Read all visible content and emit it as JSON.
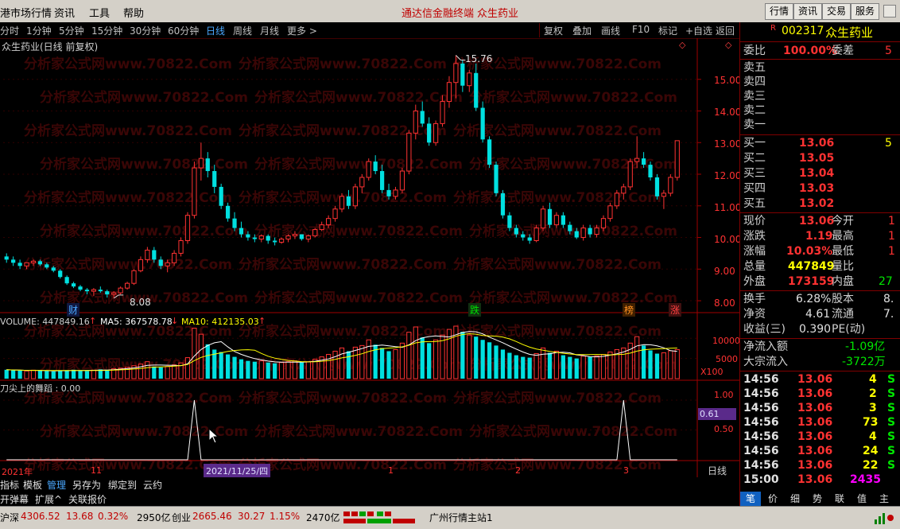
{
  "menubar": {
    "items": [
      "港市场行情",
      "资讯",
      "工具",
      "帮助"
    ],
    "app_title": "通达信金融终端",
    "stock_title": "众生药业",
    "right_buttons": [
      "行情",
      "资讯",
      "交易",
      "服务"
    ]
  },
  "periodbar": {
    "periods": [
      "分时",
      "1分钟",
      "5分钟",
      "15分钟",
      "30分钟",
      "60分钟",
      "日线",
      "周线",
      "月线",
      "更多 >"
    ],
    "active": "日线",
    "right_buttons": [
      "复权",
      "叠加",
      "画线",
      "F10",
      "标记",
      "+自选",
      "返回"
    ]
  },
  "chart": {
    "title": "众生药业(日线 前复权)",
    "high_label": "15.76",
    "low_label": "8.08",
    "y_ticks": [
      "15.00",
      "14.00",
      "13.00",
      "12.00",
      "11.00",
      "10.00",
      "9.00",
      "8.00"
    ],
    "event_tags": [
      "财",
      "跌",
      "榜",
      "涨"
    ],
    "volume_legend": {
      "volume": "VOLUME: 447849.16",
      "ma5": "MA5: 367578.78",
      "ma10": "MA10: 412135.03"
    },
    "volume_ticks": [
      "10000",
      "5000",
      "X100"
    ],
    "indicator_legend": "刀尖上的舞蹈 : 0.00",
    "indicator_ticks": [
      "1.00",
      "0.50"
    ],
    "indicator_value": "0.61",
    "date_axis": {
      "year": "2021年",
      "labels": [
        "11",
        "1",
        "2",
        "3"
      ],
      "cursor_date": "2021/11/25/四"
    },
    "period_label": "日线",
    "zoom_controls": [
      "+",
      "-",
      "0"
    ],
    "watermark": "分析家公式网www.70822.Com",
    "chart_data": {
      "type": "candlestick",
      "ylim": [
        7.8,
        16.1
      ],
      "y_ticks": [
        15,
        14,
        13,
        12,
        11,
        10,
        9,
        8
      ],
      "high": 15.76,
      "low": 8.08,
      "candles_ohlc": [
        [
          9.4,
          9.5,
          9.2,
          9.3
        ],
        [
          9.3,
          9.4,
          9.1,
          9.2
        ],
        [
          9.2,
          9.3,
          9.0,
          9.1
        ],
        [
          9.1,
          9.2,
          9.0,
          9.2
        ],
        [
          9.2,
          9.3,
          9.1,
          9.25
        ],
        [
          9.25,
          9.3,
          9.1,
          9.15
        ],
        [
          9.15,
          9.2,
          9.0,
          9.05
        ],
        [
          9.05,
          9.1,
          8.9,
          8.95
        ],
        [
          8.95,
          9.0,
          8.7,
          8.75
        ],
        [
          8.75,
          8.8,
          8.5,
          8.55
        ],
        [
          8.55,
          8.6,
          8.4,
          8.45
        ],
        [
          8.45,
          8.5,
          8.3,
          8.35
        ],
        [
          8.35,
          8.4,
          8.2,
          8.3
        ],
        [
          8.3,
          8.4,
          8.15,
          8.35
        ],
        [
          8.35,
          8.45,
          8.25,
          8.3
        ],
        [
          8.3,
          8.35,
          8.1,
          8.2
        ],
        [
          8.2,
          8.3,
          8.08,
          8.25
        ],
        [
          8.25,
          8.45,
          8.2,
          8.4
        ],
        [
          8.4,
          8.6,
          8.35,
          8.55
        ],
        [
          8.55,
          9.0,
          8.5,
          8.95
        ],
        [
          8.95,
          9.4,
          8.9,
          9.3
        ],
        [
          9.3,
          9.7,
          9.2,
          9.6
        ],
        [
          9.6,
          9.7,
          9.2,
          9.3
        ],
        [
          9.3,
          9.4,
          9.0,
          9.1
        ],
        [
          9.1,
          9.3,
          8.9,
          9.2
        ],
        [
          9.2,
          9.6,
          9.1,
          9.5
        ],
        [
          9.5,
          10.0,
          9.4,
          9.9
        ],
        [
          9.9,
          10.8,
          9.8,
          10.7
        ],
        [
          10.7,
          12.4,
          10.6,
          12.2
        ],
        [
          12.2,
          13.0,
          11.8,
          12.5
        ],
        [
          12.5,
          12.7,
          11.9,
          12.1
        ],
        [
          12.1,
          12.3,
          11.4,
          11.6
        ],
        [
          11.6,
          11.7,
          10.9,
          11.0
        ],
        [
          11.0,
          11.1,
          10.5,
          10.6
        ],
        [
          10.6,
          10.8,
          10.2,
          10.3
        ],
        [
          10.3,
          10.5,
          10.0,
          10.1
        ],
        [
          10.1,
          10.2,
          9.9,
          10.0
        ],
        [
          10.0,
          10.1,
          9.85,
          9.95
        ],
        [
          9.95,
          10.1,
          9.85,
          10.05
        ],
        [
          10.05,
          10.1,
          9.8,
          9.9
        ],
        [
          9.9,
          10.0,
          9.75,
          9.85
        ],
        [
          9.85,
          10.0,
          9.8,
          9.95
        ],
        [
          9.95,
          10.1,
          9.85,
          10.05
        ],
        [
          10.05,
          10.2,
          9.95,
          10.1
        ],
        [
          10.1,
          10.1,
          9.9,
          9.95
        ],
        [
          9.95,
          10.1,
          9.85,
          10.05
        ],
        [
          10.05,
          10.3,
          10.0,
          10.25
        ],
        [
          10.25,
          10.5,
          10.2,
          10.4
        ],
        [
          10.4,
          10.7,
          10.3,
          10.6
        ],
        [
          10.6,
          11.0,
          10.5,
          10.9
        ],
        [
          10.9,
          11.4,
          10.8,
          11.3
        ],
        [
          11.3,
          11.5,
          10.9,
          11.0
        ],
        [
          11.0,
          11.7,
          10.9,
          11.6
        ],
        [
          11.6,
          12.0,
          11.4,
          11.9
        ],
        [
          11.9,
          12.5,
          11.8,
          12.4
        ],
        [
          12.4,
          12.6,
          12.0,
          12.1
        ],
        [
          12.1,
          12.3,
          11.4,
          11.5
        ],
        [
          11.5,
          11.7,
          11.2,
          11.3
        ],
        [
          11.3,
          11.6,
          11.2,
          11.5
        ],
        [
          11.5,
          12.2,
          11.4,
          12.1
        ],
        [
          12.1,
          13.4,
          12.0,
          13.3
        ],
        [
          13.3,
          14.2,
          13.1,
          14.0
        ],
        [
          14.0,
          14.3,
          13.5,
          13.6
        ],
        [
          13.6,
          13.8,
          12.9,
          13.0
        ],
        [
          13.0,
          13.7,
          12.9,
          13.6
        ],
        [
          13.6,
          14.5,
          13.5,
          14.3
        ],
        [
          14.3,
          15.1,
          14.1,
          14.9
        ],
        [
          14.9,
          15.76,
          14.4,
          15.5
        ],
        [
          15.5,
          15.6,
          14.6,
          14.8
        ],
        [
          14.8,
          15.3,
          14.6,
          15.2
        ],
        [
          15.2,
          15.5,
          14.0,
          14.1
        ],
        [
          14.1,
          14.3,
          13.0,
          13.1
        ],
        [
          13.1,
          13.2,
          12.2,
          12.3
        ],
        [
          12.3,
          12.4,
          11.3,
          11.4
        ],
        [
          11.4,
          11.5,
          10.6,
          10.7
        ],
        [
          10.7,
          10.8,
          10.2,
          10.3
        ],
        [
          10.3,
          10.4,
          10.0,
          10.1
        ],
        [
          10.1,
          10.2,
          9.9,
          10.0
        ],
        [
          10.0,
          10.1,
          9.8,
          9.9
        ],
        [
          9.9,
          10.4,
          9.85,
          10.3
        ],
        [
          10.3,
          11.0,
          10.2,
          10.9
        ],
        [
          10.9,
          11.1,
          10.3,
          10.4
        ],
        [
          10.4,
          10.8,
          10.3,
          10.7
        ],
        [
          10.7,
          10.8,
          10.3,
          10.4
        ],
        [
          10.4,
          10.5,
          10.1,
          10.2
        ],
        [
          10.2,
          10.3,
          9.95,
          10.0
        ],
        [
          10.0,
          10.4,
          9.9,
          10.3
        ],
        [
          10.3,
          10.4,
          10.0,
          10.1
        ],
        [
          10.1,
          10.4,
          10.0,
          10.3
        ],
        [
          10.3,
          10.7,
          10.2,
          10.6
        ],
        [
          10.6,
          11.1,
          10.5,
          11.0
        ],
        [
          11.0,
          11.5,
          10.9,
          11.4
        ],
        [
          11.4,
          11.7,
          11.2,
          11.6
        ],
        [
          11.6,
          12.5,
          11.5,
          12.4
        ],
        [
          12.4,
          13.2,
          12.2,
          12.5
        ],
        [
          12.5,
          12.7,
          12.2,
          12.3
        ],
        [
          12.3,
          12.4,
          11.8,
          11.9
        ],
        [
          11.9,
          12.0,
          11.2,
          11.3
        ],
        [
          11.3,
          11.5,
          10.9,
          11.4
        ],
        [
          11.4,
          12.0,
          11.3,
          11.9
        ],
        [
          11.9,
          13.06,
          11.8,
          13.06
        ]
      ],
      "volume_ylim": [
        0,
        13000
      ],
      "volume_ticks": [
        10000,
        5000
      ],
      "volumes": [
        2200,
        2100,
        2000,
        1900,
        2100,
        2000,
        1900,
        1800,
        2000,
        2100,
        2200,
        2000,
        1900,
        2100,
        2300,
        2200,
        2500,
        2600,
        2800,
        3200,
        3600,
        4200,
        3000,
        2800,
        3000,
        3400,
        3900,
        5200,
        12500,
        11000,
        8500,
        7200,
        6600,
        6000,
        5400,
        4800,
        4400,
        4200,
        4400,
        4000,
        3800,
        4000,
        4200,
        4400,
        4000,
        4200,
        4800,
        5400,
        6000,
        6800,
        7600,
        6800,
        7800,
        8200,
        9600,
        8400,
        7600,
        6800,
        7200,
        8800,
        11500,
        12800,
        10200,
        8800,
        9600,
        10800,
        12200,
        13000,
        11600,
        10800,
        10400,
        9600,
        9000,
        8200,
        7200,
        6400,
        5800,
        5400,
        5200,
        6200,
        7600,
        6400,
        6800,
        5800,
        5400,
        5000,
        5600,
        5400,
        5600,
        6000,
        6600,
        7200,
        7600,
        8800,
        10400,
        8200,
        7000,
        6200,
        6400,
        6900,
        7200
      ],
      "indicator_ylim": [
        0,
        1.2
      ],
      "indicator_ticks": [
        1.0,
        0.5
      ],
      "indicator_spikes": [
        {
          "index": 28,
          "value": 1.0
        },
        {
          "index": 92,
          "value": 1.0
        }
      ]
    }
  },
  "quote": {
    "code": "002317",
    "name": "众生药业",
    "weibi_label": "委比",
    "weibi_value": "100.00%",
    "weicha_label": "委差",
    "weicha_value": "5",
    "asks": [
      {
        "label": "卖五"
      },
      {
        "label": "卖四"
      },
      {
        "label": "卖三"
      },
      {
        "label": "卖二"
      },
      {
        "label": "卖一"
      }
    ],
    "bids": [
      {
        "label": "买一",
        "price": "13.06",
        "vol": "5"
      },
      {
        "label": "买二",
        "price": "13.05",
        "vol": ""
      },
      {
        "label": "买三",
        "price": "13.04",
        "vol": ""
      },
      {
        "label": "买四",
        "price": "13.03",
        "vol": ""
      },
      {
        "label": "买五",
        "price": "13.02",
        "vol": ""
      }
    ],
    "stats_left": [
      {
        "label": "现价",
        "value": "13.06",
        "cls": "red"
      },
      {
        "label": "涨跌",
        "value": "1.19",
        "cls": "red"
      },
      {
        "label": "涨幅",
        "value": "10.03%",
        "cls": "red"
      },
      {
        "label": "总量",
        "value": "447849",
        "cls": "yellow"
      },
      {
        "label": "外盘",
        "value": "173159",
        "cls": "red"
      }
    ],
    "stats_right": [
      {
        "label": "今开",
        "value": "1",
        "cls": "red"
      },
      {
        "label": "最高",
        "value": "1",
        "cls": "red"
      },
      {
        "label": "最低",
        "value": "1",
        "cls": "red"
      },
      {
        "label": "量比",
        "value": "",
        "cls": "red"
      },
      {
        "label": "内盘",
        "value": "27",
        "cls": "green"
      }
    ],
    "stats2_left": [
      {
        "label": "换手",
        "value": "6.28%"
      },
      {
        "label": "净资",
        "value": "4.61"
      },
      {
        "label": "收益(三)",
        "value": "0.390"
      }
    ],
    "stats2_right": [
      {
        "label": "股本",
        "value": "8."
      },
      {
        "label": "流通",
        "value": "7."
      },
      {
        "label": "PE(动)",
        "value": ""
      }
    ],
    "flow": [
      {
        "label": "净流入额",
        "value": "-1.09亿"
      },
      {
        "label": "大宗流入",
        "value": "-3722万"
      }
    ],
    "ticks": [
      {
        "time": "14:56",
        "price": "13.06",
        "vol": "4",
        "side": "S"
      },
      {
        "time": "14:56",
        "price": "13.06",
        "vol": "2",
        "side": "S"
      },
      {
        "time": "14:56",
        "price": "13.06",
        "vol": "3",
        "side": "S"
      },
      {
        "time": "14:56",
        "price": "13.06",
        "vol": "73",
        "side": "S"
      },
      {
        "time": "14:56",
        "price": "13.06",
        "vol": "4",
        "side": "S"
      },
      {
        "time": "14:56",
        "price": "13.06",
        "vol": "24",
        "side": "S"
      },
      {
        "time": "14:56",
        "price": "13.06",
        "vol": "22",
        "side": "S"
      },
      {
        "time": "15:00",
        "price": "13.06",
        "vol": "2435",
        "side": ""
      }
    ],
    "tabs": [
      "笔",
      "价",
      "细",
      "势",
      "联",
      "值",
      "主"
    ]
  },
  "toolrow": {
    "items": [
      "指标",
      "模板",
      "管理",
      "另存为",
      "绑定到",
      "云约"
    ]
  },
  "tabrow": {
    "items": [
      "开弹幕",
      "扩展^",
      "关联报价"
    ]
  },
  "statusbar": {
    "sh_label": "沪深",
    "sh_value": "4306.52",
    "sh_change": "13.68",
    "sh_pct": "0.32%",
    "sh_amount": "2950亿",
    "cy_label": "创业",
    "cy_value": "2665.46",
    "cy_change": "30.27",
    "cy_pct": "1.15%",
    "cy_amount": "2470亿",
    "server": "广州行情主站1"
  },
  "colors": {
    "up": "#ff3232",
    "down": "#00e0e0",
    "bg": "#000000",
    "grid": "#800000",
    "ma5": "#ffffff",
    "ma10": "#ffff00"
  }
}
